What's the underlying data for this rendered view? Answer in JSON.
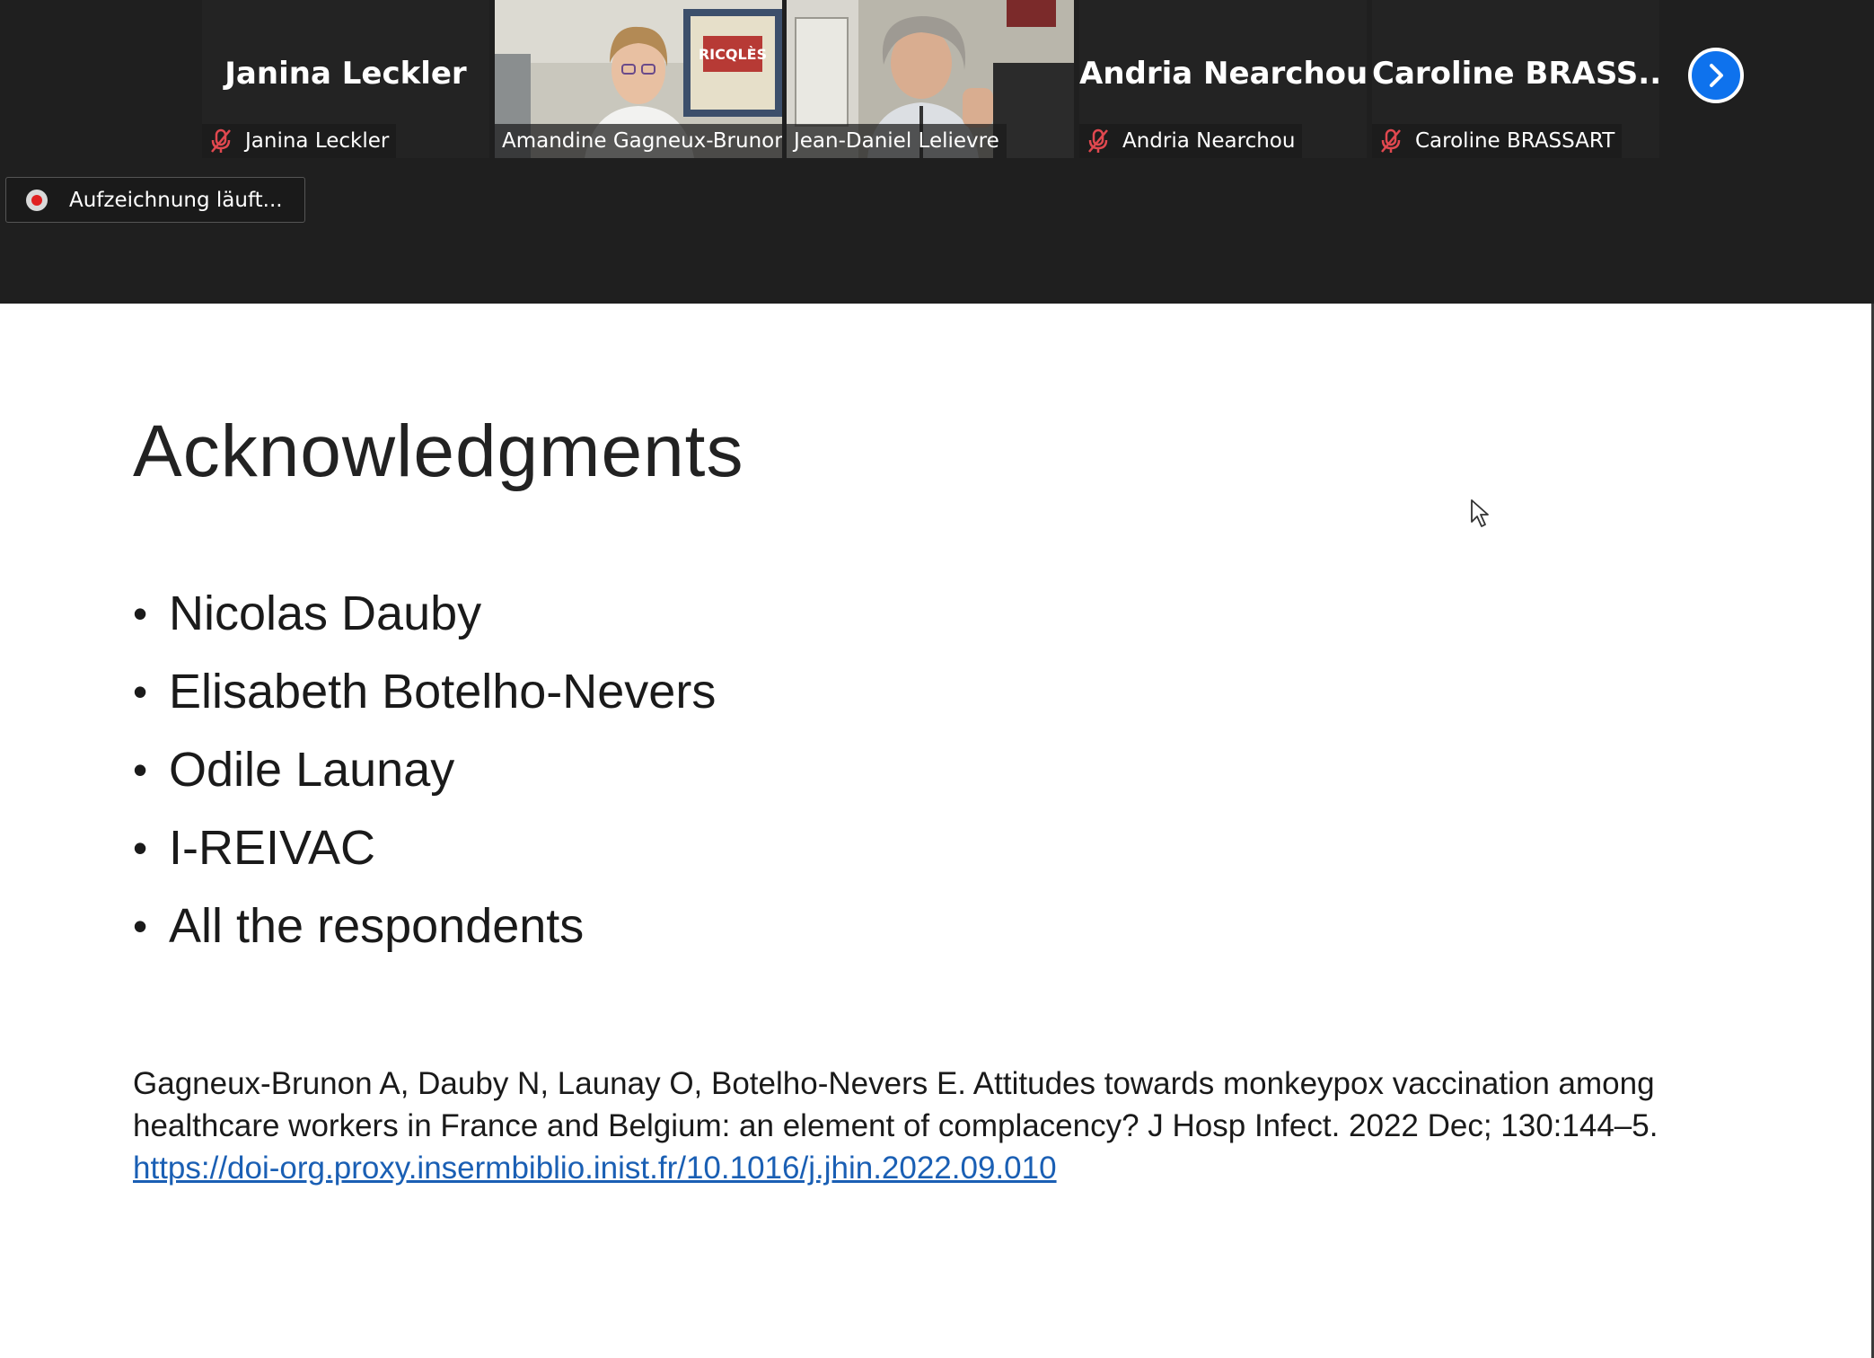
{
  "participants": [
    {
      "big_name": "Janina Leckler",
      "label": "Janina Leckler",
      "muted": true,
      "video": false
    },
    {
      "big_name": "",
      "label": "Amandine Gagneux-Brunon",
      "muted": false,
      "video": true,
      "poster_text": "RICQLÈS"
    },
    {
      "big_name": "",
      "label": "Jean-Daniel Lelievre",
      "muted": false,
      "video": true,
      "active_speaker": true
    },
    {
      "big_name": "Andria Nearchou",
      "label": "Andria Nearchou",
      "muted": true,
      "video": false
    },
    {
      "big_name": "Caroline  BRASS...",
      "label": "Caroline BRASSART",
      "muted": true,
      "video": false
    }
  ],
  "next_page_icon": "chevron-right-icon",
  "recording": {
    "text": "Aufzeichnung läuft..."
  },
  "slide": {
    "title": "Acknowledgments",
    "bullets": [
      "Nicolas Dauby",
      "Elisabeth Botelho-Nevers",
      "Odile Launay",
      "I-REIVAC",
      "All the respondents"
    ],
    "citation_text": "Gagneux-Brunon A, Dauby N, Launay O, Botelho-Nevers E. Attitudes towards monkeypox vaccination among healthcare workers in France and Belgium: an element of complacency? J Hosp Infect. 2022 Dec; 130:144–5. ",
    "citation_link": "https://doi-org.proxy.insermbiblio.inist.fr/10.1016/j.jhin.2022.09.010"
  },
  "colors": {
    "topbar": "#1f1f1f",
    "accent_blue": "#0e72ed",
    "mute_red": "#e0484f",
    "active_green": "#8dc63f",
    "link": "#1a5fb4"
  }
}
